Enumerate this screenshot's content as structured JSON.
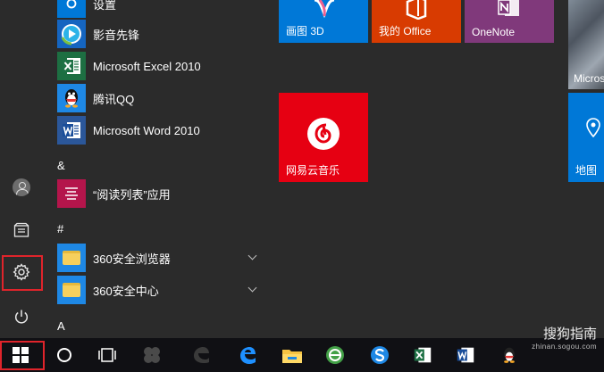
{
  "app_list": {
    "items": [
      {
        "label": "设置",
        "icon": "settings-gear-icon"
      },
      {
        "label": "影音先锋",
        "icon": "xfplay-icon"
      },
      {
        "label": "Microsoft Excel 2010",
        "icon": "excel-icon"
      },
      {
        "label": "腾讯QQ",
        "icon": "qq-penguin-icon"
      },
      {
        "label": "Microsoft Word 2010",
        "icon": "word-icon"
      },
      {
        "label": "“阅读列表”应用",
        "icon": "reading-list-icon"
      },
      {
        "label": "360安全浏览器",
        "icon": "folder-icon"
      },
      {
        "label": "360安全中心",
        "icon": "folder-icon"
      }
    ],
    "sections": [
      "&",
      "#",
      "A"
    ]
  },
  "tiles": {
    "paint3d": {
      "label": "画图 3D",
      "color": "#0078d7"
    },
    "office": {
      "label": "我的 Office",
      "color": "#d83b01"
    },
    "onenote": {
      "label": "OneNote",
      "color": "#80397b"
    },
    "photo": {
      "label": "Micros"
    },
    "netease": {
      "label": "网易云音乐",
      "color": "#e60012"
    },
    "maps": {
      "label": "地图",
      "color": "#0078d7"
    }
  },
  "taskbar": {
    "items": [
      "windows-start-icon",
      "cortana-circle-icon",
      "task-view-icon",
      "pinned-app-icon",
      "edge-ghost-icon",
      "edge-icon",
      "file-explorer-icon",
      "browser-green-icon",
      "sogou-s-icon",
      "excel-icon",
      "word-icon",
      "qq-penguin-icon"
    ]
  },
  "watermark": {
    "text": "搜狗指南",
    "sub": "zhinan.sogou.com"
  },
  "colors": {
    "highlight": "#e0242b",
    "accent_blue": "#0078d7"
  }
}
